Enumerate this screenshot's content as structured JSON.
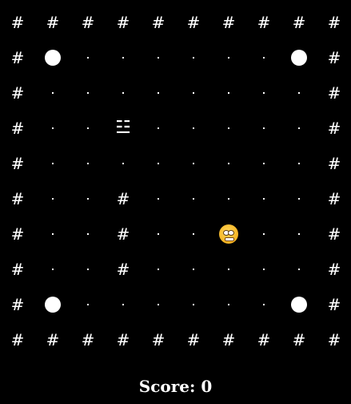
{
  "board": {
    "rows": [
      "##########",
      "#o......o#",
      "#........#",
      "#..G.....#",
      "#........#",
      "#..#.....#",
      "#..#..P..#",
      "#..#.....#",
      "#o......o#",
      "##########"
    ],
    "legend": {
      "#": "wall",
      ".": "pellet",
      "o": "power-pellet",
      "G": "ghost",
      "P": "player"
    },
    "wall_glyph": "#",
    "ghost_glyph": "☳"
  },
  "score": {
    "label": "Score: 0",
    "value": 0
  },
  "colors": {
    "background": "#000000",
    "foreground": "#ffffff",
    "player": "#f5b322"
  }
}
